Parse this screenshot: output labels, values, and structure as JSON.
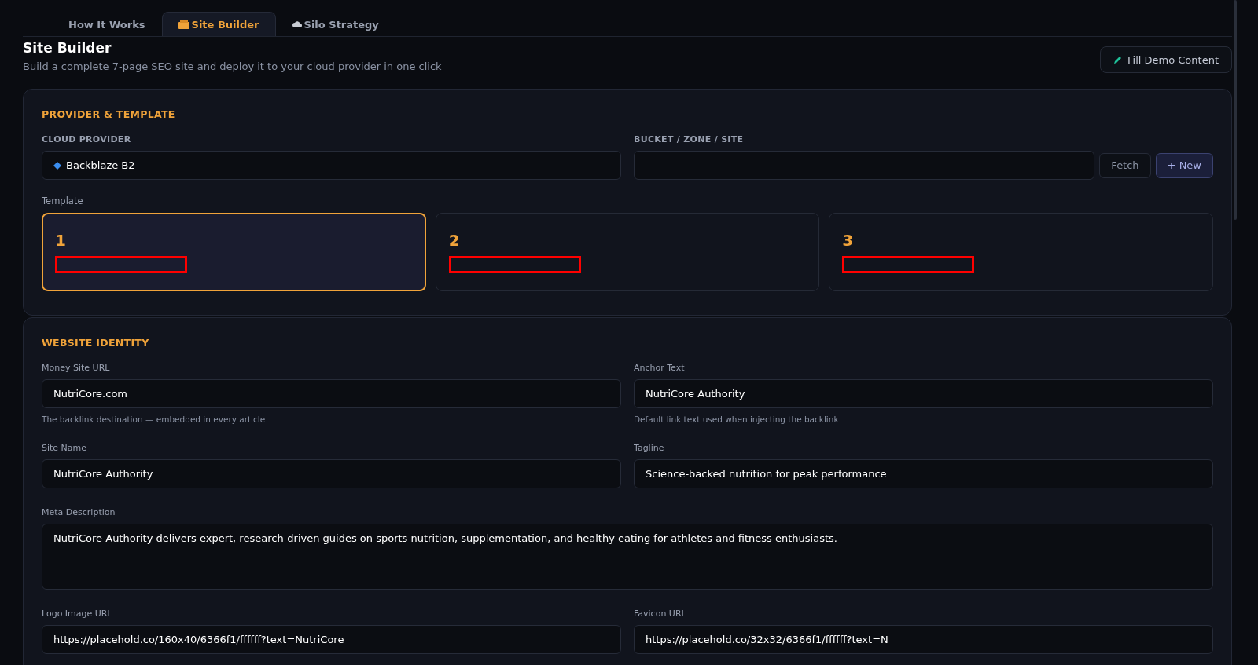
{
  "tabs": [
    {
      "label": "How It Works",
      "selected": false
    },
    {
      "label": "Site Builder",
      "selected": true
    },
    {
      "label": "Silo Strategy",
      "selected": false
    }
  ],
  "header": {
    "title": "Site Builder",
    "subtitle": "Build a complete 7-page SEO site and deploy it to your cloud provider in one click",
    "action": "Fill Demo Content"
  },
  "provider_section": {
    "title": "PROVIDER & TEMPLATE",
    "provider_label": "CLOUD PROVIDER",
    "provider_value": "Backblaze B2",
    "bucket_label": "BUCKET / ZONE / SITE",
    "buttons": [
      "Fetch",
      "+ New"
    ],
    "template_label": "Template",
    "templates": [
      {
        "number": "1",
        "selected": true
      },
      {
        "number": "2",
        "selected": false
      },
      {
        "number": "3",
        "selected": false
      }
    ]
  },
  "identity_section": {
    "title": "WEBSITE IDENTITY",
    "fields": [
      {
        "label": "Money Site URL",
        "value": "NutriCore.com",
        "hint": "The backlink destination — embedded in every article",
        "kind": "input"
      },
      {
        "label": "Anchor Text",
        "value": "NutriCore Authority",
        "hint": "Default link text used when injecting the backlink",
        "kind": "input"
      },
      {
        "label": "Site Name",
        "value": "NutriCore Authority",
        "kind": "input"
      },
      {
        "label": "Tagline",
        "value": "Science-backed nutrition for peak performance",
        "kind": "input"
      },
      {
        "label": "Meta Description",
        "value": "NutriCore Authority delivers expert, research-driven guides on sports nutrition, supplementation, and healthy eating for athletes and fitness enthusiasts.",
        "kind": "textarea"
      },
      {
        "label": "Logo Image URL",
        "value": "https://placehold.co/160x40/6366f1/ffffff?text=NutriCore",
        "kind": "input"
      },
      {
        "label": "Favicon URL",
        "value": "https://placehold.co/32x32/6366f1/ffffff?text=N",
        "kind": "input"
      }
    ]
  }
}
